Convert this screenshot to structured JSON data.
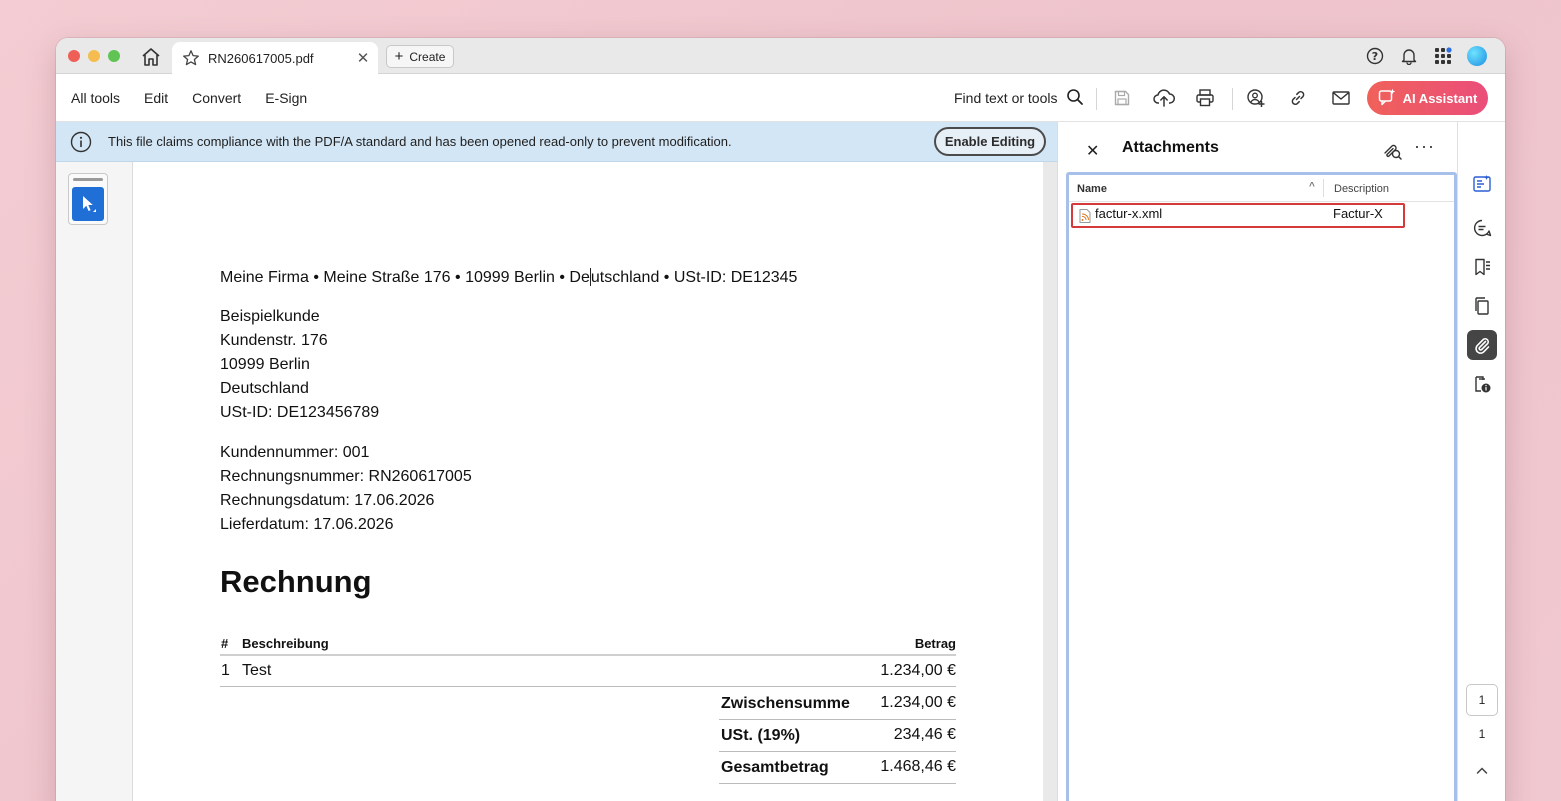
{
  "titlebar": {
    "tab_title": "RN260617005.pdf",
    "create_label": "Create"
  },
  "toolbar": {
    "menu": [
      "All tools",
      "Edit",
      "Convert",
      "E-Sign"
    ],
    "find_label": "Find text or tools",
    "ai_label": "AI Assistant",
    "ai_color": "#f0615a"
  },
  "banner": {
    "message": "This file claims compliance with the PDF/A standard and has been opened read-only to prevent modification.",
    "enable_label": "Enable Editing"
  },
  "document": {
    "sender_line_a": "Meine Firma • Meine Straße 176 • 10999 Berlin • De",
    "sender_line_b": "utschland • USt-ID: DE12345",
    "recipient": [
      "Beispielkunde",
      "Kundenstr. 176",
      "10999 Berlin",
      "Deutschland",
      "USt-ID: DE123456789"
    ],
    "meta": [
      "Kundennummer: 001",
      "Rechnungsnummer: RN260617005",
      "Rechnungsdatum: 17.06.2026",
      "Lieferdatum: 17.06.2026"
    ],
    "heading": "Rechnung",
    "table": {
      "col_num": "#",
      "col_desc": "Beschreibung",
      "col_amount": "Betrag",
      "rows": [
        {
          "num": "1",
          "desc": "Test",
          "amount": "1.234,00 €"
        }
      ],
      "totals": [
        {
          "label": "Zwischensumme",
          "amount": "1.234,00 €"
        },
        {
          "label": "USt. (19%)",
          "amount": "234,46 €"
        },
        {
          "label": "Gesamtbetrag",
          "amount": "1.468,46 €"
        }
      ]
    }
  },
  "attachments": {
    "title": "Attachments",
    "col_name": "Name",
    "col_description": "Description",
    "items": [
      {
        "name": "factur-x.xml",
        "description": "Factur-X"
      }
    ],
    "highlight_color": "#d43a3a"
  },
  "pager": {
    "current": "1",
    "total": "1"
  }
}
